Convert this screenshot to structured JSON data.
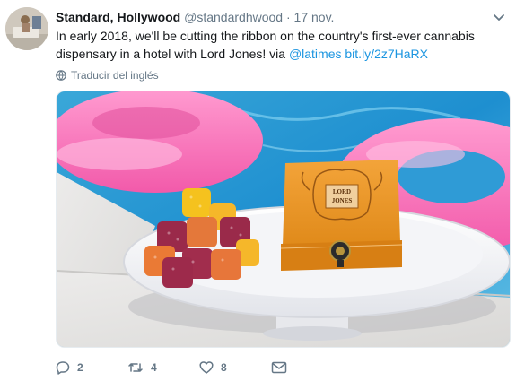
{
  "tweet": {
    "author_name": "Standard, Hollywood",
    "handle": "@standardhwood",
    "separator": "·",
    "date": "17 nov.",
    "text_before": "In early 2018, we'll be cutting the ribbon on the country's first-ever cannabis dispensary in a hotel with Lord Jones! via ",
    "mention": "@latimes",
    "link": "bit.ly/2z7HaRX",
    "translate_label": "Traducir del inglés",
    "box_brand_line1": "LORD",
    "box_brand_line2": "JONES"
  },
  "actions": {
    "replies": "2",
    "retweets": "4",
    "likes": "8"
  },
  "icons": {
    "reply": "reply-icon",
    "retweet": "retweet-icon",
    "like": "heart-icon",
    "message": "envelope-icon",
    "caret": "chevron-down-icon",
    "globe": "globe-icon"
  },
  "colors": {
    "link": "#1b95e0",
    "muted": "#657786",
    "text": "#14171a"
  }
}
